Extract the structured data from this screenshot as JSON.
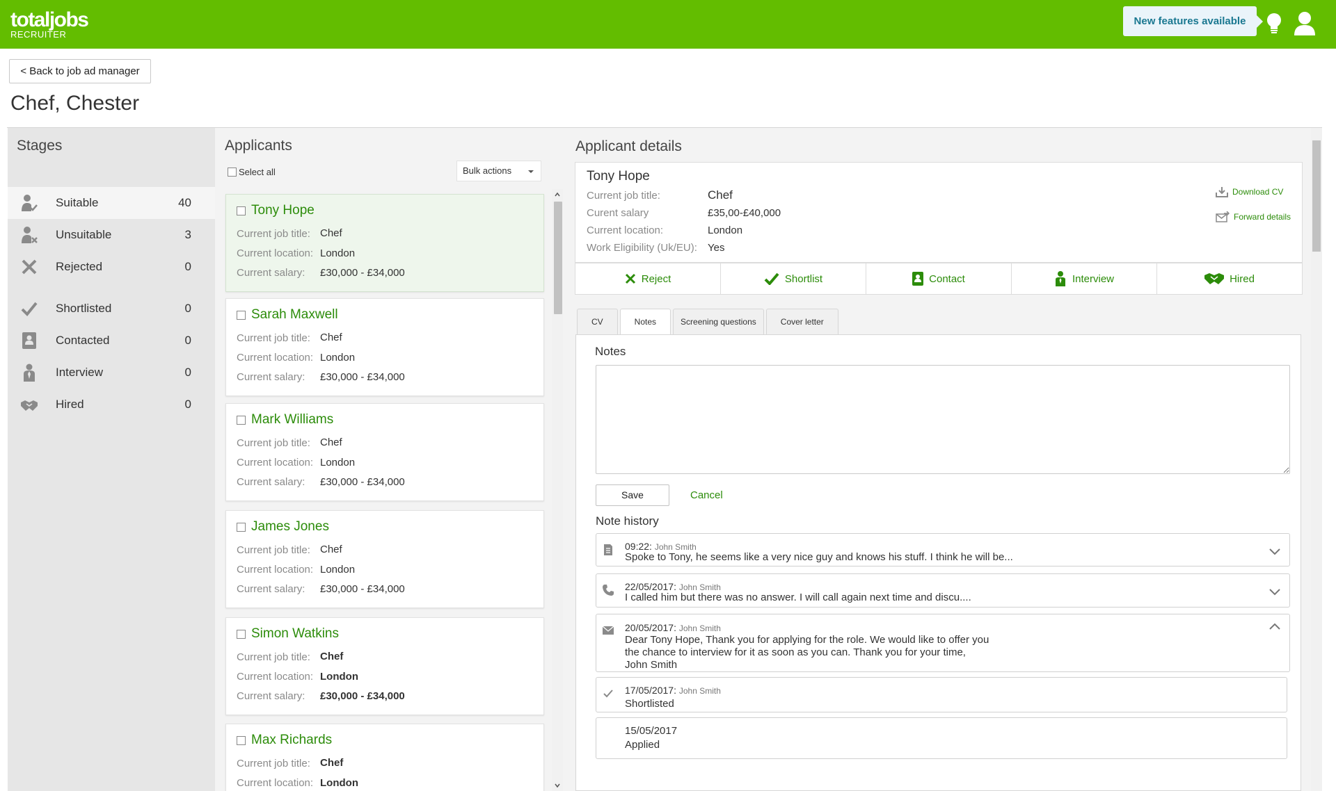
{
  "header": {
    "brand_name": "totaljobs",
    "brand_sub": "RECRUITER",
    "new_features": "New features available",
    "brand_color": "#63bd00"
  },
  "page": {
    "back_label": "< Back to job ad manager",
    "title": "Chef, Chester"
  },
  "stages": {
    "title": "Stages",
    "items": [
      {
        "label": "Suitable",
        "count": "40",
        "icon": "suitable-person-icon"
      },
      {
        "label": "Unsuitable",
        "count": "3",
        "icon": "unsuitable-person-icon"
      },
      {
        "label": "Rejected",
        "count": "0",
        "icon": "cross-icon"
      },
      {
        "label": "Shortlisted",
        "count": "0",
        "icon": "check-icon"
      },
      {
        "label": "Contacted",
        "count": "0",
        "icon": "contact-card-icon"
      },
      {
        "label": "Interview",
        "count": "0",
        "icon": "interview-person-icon"
      },
      {
        "label": "Hired",
        "count": "0",
        "icon": "handshake-icon"
      }
    ]
  },
  "applicants": {
    "title": "Applicants",
    "select_all": "Select all",
    "bulk_actions": "Bulk actions",
    "labels": {
      "job_title": "Current job title:",
      "location": "Current location:",
      "salary": "Current salary:"
    },
    "list": [
      {
        "name": "Tony Hope",
        "job_title": "Chef",
        "location": "London",
        "salary": "£30,000 - £34,000"
      },
      {
        "name": "Sarah Maxwell",
        "job_title": "Chef",
        "location": "London",
        "salary": "£30,000 - £34,000"
      },
      {
        "name": "Mark Williams",
        "job_title": "Chef",
        "location": "London",
        "salary": "£30,000 - £34,000"
      },
      {
        "name": "James Jones",
        "job_title": "Chef",
        "location": "London",
        "salary": "£30,000 - £34,000"
      },
      {
        "name": "Simon Watkins",
        "job_title": "Chef",
        "location": "London",
        "salary": "£30,000 - £34,000"
      },
      {
        "name": "Max Richards",
        "job_title": "Chef",
        "location": "London",
        "salary": ""
      }
    ]
  },
  "details": {
    "title": "Applicant details",
    "name": "Tony Hope",
    "rows": [
      {
        "label": "Current job title:",
        "value": "Chef"
      },
      {
        "label": "Curent salary",
        "value": "£35,00-£40,000"
      },
      {
        "label": "Current location:",
        "value": "London"
      },
      {
        "label": "Work Eligibility (Uk/EU):",
        "value": "Yes"
      }
    ],
    "download_cv": "Download CV",
    "forward_details": "Forward details",
    "actions": [
      "Reject",
      "Shortlist",
      "Contact",
      "Interview",
      "Hired"
    ],
    "tabs": [
      "CV",
      "Notes",
      "Screening questions",
      "Cover letter"
    ],
    "active_tab": "Notes"
  },
  "notes": {
    "label": "Notes",
    "textarea_value": "",
    "save": "Save",
    "cancel": "Cancel",
    "history_label": "Note history",
    "history": [
      {
        "icon": "document-icon",
        "time": "09:22:",
        "author": "John Smith",
        "text": "Spoke to Tony, he seems like a very nice guy and knows his stuff. I think he will be..."
      },
      {
        "icon": "phone-icon",
        "time": "22/05/2017:",
        "author": "John Smith",
        "text": "I called him but there was no answer. I will call again next time and discu...."
      },
      {
        "icon": "envelope-icon",
        "time": "20/05/2017:",
        "author": "John Smith",
        "lines": [
          "Dear Tony Hope, Thank you for applying for the role. We would like to offer you",
          "the chance to interview for it as soon as you can. Thank you for your time,",
          "John Smith"
        ]
      },
      {
        "icon": "check-icon",
        "time": "17/05/2017:",
        "author": "John Smith",
        "text": "Shortlisted"
      },
      {
        "time": "15/05/2017",
        "text": "Applied"
      }
    ]
  }
}
